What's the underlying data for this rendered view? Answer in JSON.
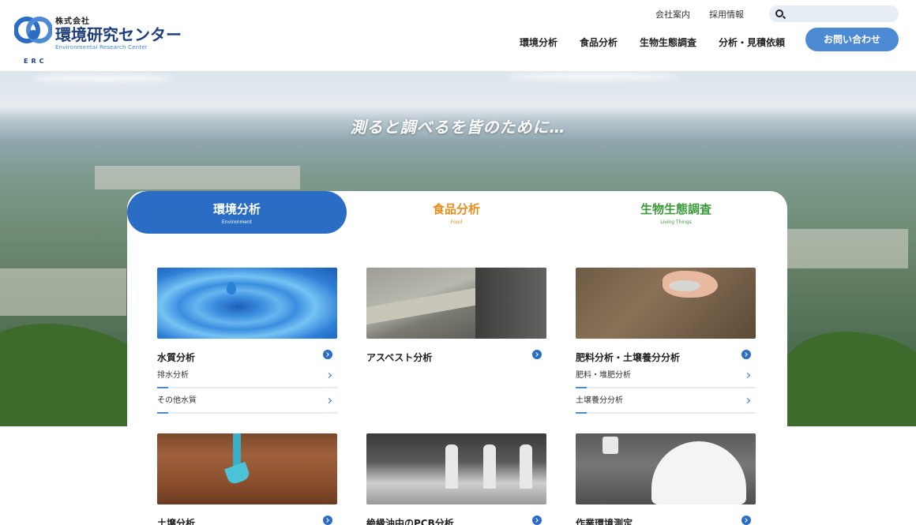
{
  "logo": {
    "sub": "株式会社",
    "name": "環境研究センター",
    "en": "Environmental Research Center",
    "abbr": "ERC"
  },
  "util_links": [
    "会社案内",
    "採用情報"
  ],
  "search": {
    "placeholder": ""
  },
  "gnav": [
    "環境分析",
    "食品分析",
    "生物生態調査",
    "分析・見積依頼"
  ],
  "contact_label": "お問い合わせ",
  "hero_tagline": "測ると調べるを皆のために…",
  "tabs": [
    {
      "label": "環境分析",
      "sub": "Environment",
      "active": true
    },
    {
      "label": "食品分析",
      "sub": "Food",
      "active": false
    },
    {
      "label": "生物生態調査",
      "sub": "Living Things",
      "active": false
    }
  ],
  "cards": [
    {
      "title": "水質分析",
      "items": [
        "排水分析",
        "その他水質"
      ]
    },
    {
      "title": "アスベスト分析",
      "items": []
    },
    {
      "title": "肥料分析・土壌養分分析",
      "items": [
        "肥料・堆肥分析",
        "土壌養分分析"
      ]
    },
    {
      "title": "土壌分析",
      "items": []
    },
    {
      "title": "絶縁油中のPCB分析",
      "items": []
    },
    {
      "title": "作業環境測定",
      "items": []
    }
  ],
  "colors": {
    "primary": "#2b6cc4",
    "contact": "#4d8ad4",
    "food": "#e88c1a",
    "living": "#3a9a3a"
  }
}
